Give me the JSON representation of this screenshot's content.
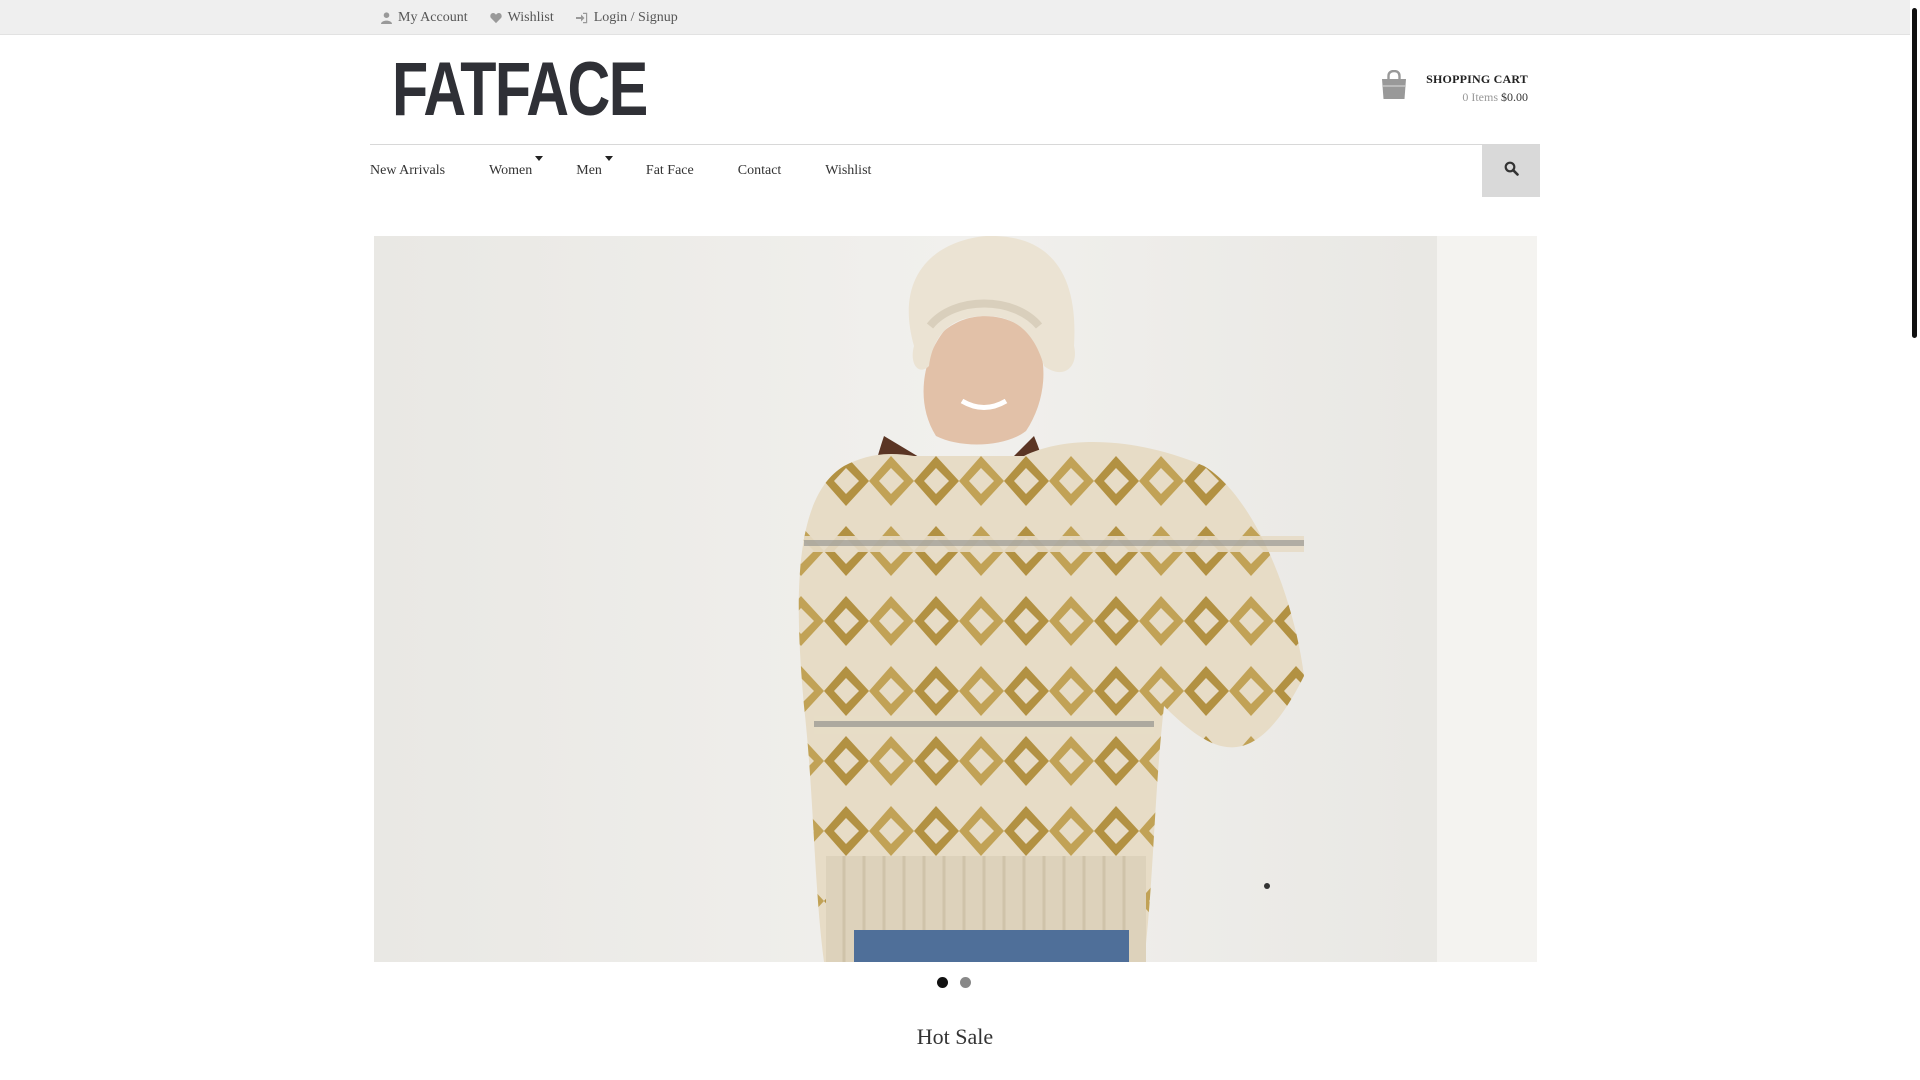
{
  "topbar": {
    "links": [
      {
        "label": "My Account",
        "icon": "user-icon"
      },
      {
        "label": "Wishlist",
        "icon": "heart-icon"
      },
      {
        "label": "Login / Signup",
        "icon": "sign-in-icon"
      }
    ]
  },
  "brand": {
    "logo_text": "FATFACE",
    "color": "#2f3036"
  },
  "cart": {
    "title": "SHOPPING CART",
    "items": "0 Items",
    "total": "$0.00",
    "icon": "shopping-bag-icon"
  },
  "nav": {
    "items": [
      {
        "label": "New Arrivals",
        "has_dropdown": false
      },
      {
        "label": "Women",
        "has_dropdown": true
      },
      {
        "label": "Men",
        "has_dropdown": true
      },
      {
        "label": "Fat Face",
        "has_dropdown": false
      },
      {
        "label": "Contact",
        "has_dropdown": false
      },
      {
        "label": "Wishlist",
        "has_dropdown": false
      }
    ],
    "search_icon": "search-icon"
  },
  "slider": {
    "slide_count": 2,
    "active_slide": 1
  },
  "section": {
    "title": "Hot Sale"
  },
  "colors": {
    "topbar_bg": "#efefef",
    "search_bg": "#d9d9d9",
    "sweater_beige": "#e7dcc6",
    "sweater_mustard": "#a9842a"
  }
}
